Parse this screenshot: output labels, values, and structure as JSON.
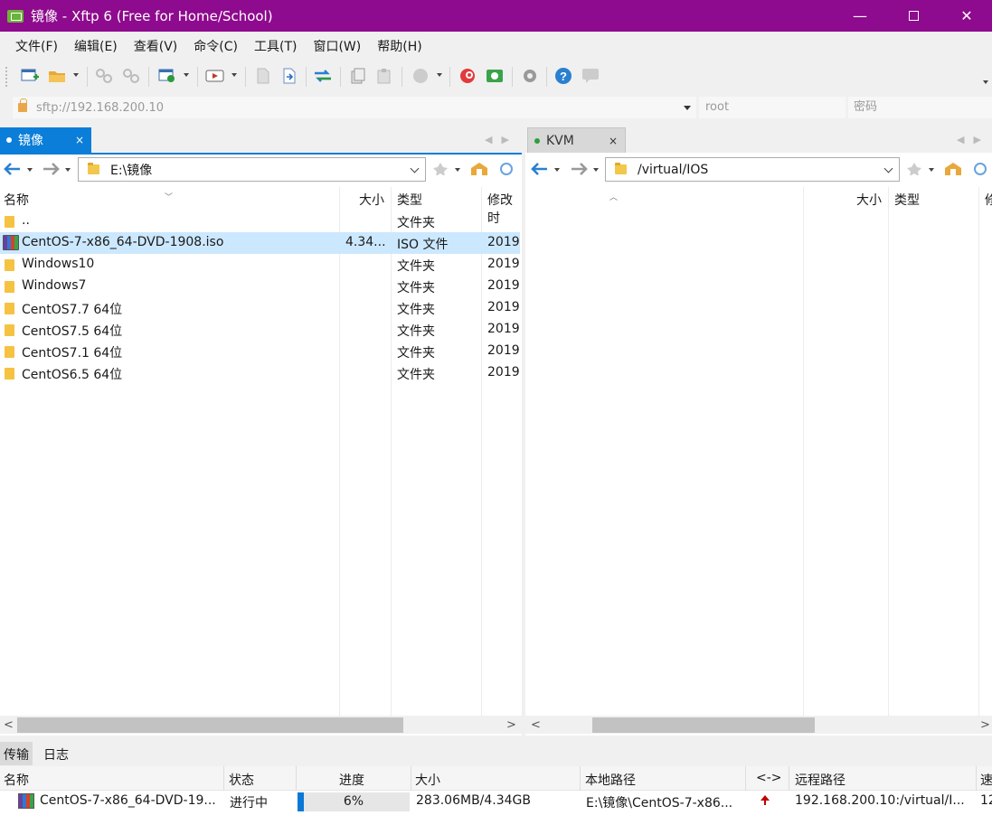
{
  "window": {
    "title": "镜像 - Xftp 6 (Free for Home/School)",
    "controls": {
      "minimize": "—",
      "close": "✕"
    }
  },
  "menu": [
    "文件(F)",
    "编辑(E)",
    "查看(V)",
    "命令(C)",
    "工具(T)",
    "窗口(W)",
    "帮助(H)"
  ],
  "toolbar": {
    "icons": [
      "new-session-icon",
      "open-folder-icon",
      "connect-icon",
      "disconnect-icon",
      "new-tab-icon",
      "terminal-icon",
      "file-icon",
      "transfer-icon",
      "sync-icon",
      "copy-icon",
      "paste-icon",
      "status-icon",
      "xshell-icon",
      "xftp-icon",
      "settings-icon",
      "help-icon",
      "chat-icon"
    ]
  },
  "address": {
    "url": "sftp://192.168.200.10",
    "user_placeholder": "root",
    "password_placeholder": "密码"
  },
  "left_panel": {
    "tab_label": "镜像",
    "tab_close": "×",
    "path": "E:\\镜像",
    "columns": [
      "名称",
      "大小",
      "类型",
      "修改时"
    ],
    "rows": [
      {
        "name": "..",
        "size": "",
        "type": "文件夹",
        "date": ""
      },
      {
        "name": "CentOS-7-x86_64-DVD-1908.iso",
        "size": "4.34...",
        "type": "ISO 文件",
        "date": "2019",
        "selected": true
      },
      {
        "name": "Windows10",
        "size": "",
        "type": "文件夹",
        "date": "2019"
      },
      {
        "name": "Windows7",
        "size": "",
        "type": "文件夹",
        "date": "2019"
      },
      {
        "name": "CentOS7.7 64位",
        "size": "",
        "type": "文件夹",
        "date": "2019"
      },
      {
        "name": "CentOS7.5 64位",
        "size": "",
        "type": "文件夹",
        "date": "2019"
      },
      {
        "name": "CentOS7.1 64位",
        "size": "",
        "type": "文件夹",
        "date": "2019"
      },
      {
        "name": "CentOS6.5 64位",
        "size": "",
        "type": "文件夹",
        "date": "2019"
      }
    ]
  },
  "right_panel": {
    "tab_label": "KVM",
    "tab_close": "×",
    "path": "/virtual/IOS",
    "columns": [
      "大小",
      "类型",
      "修"
    ]
  },
  "bottom": {
    "tabs": [
      "传输",
      "日志"
    ],
    "columns": [
      "名称",
      "状态",
      "进度",
      "大小",
      "本地路径",
      "<->",
      "远程路径",
      "速"
    ],
    "transfer": {
      "name": "CentOS-7-x86_64-DVD-19...",
      "status": "进行中",
      "progress_label": "6%",
      "progress": 0.06,
      "size": "283.06MB/4.34GB",
      "local_path": "E:\\镜像\\CentOS-7-x86...",
      "direction": "up-arrow-icon",
      "remote_path": "192.168.200.10:/virtual/I...",
      "speed": "12"
    }
  },
  "colors": {
    "titlebar": "#8e0a8e",
    "active_tab": "#0a7ed8",
    "selection": "#cce8ff",
    "progress_fill": "#0a78d4"
  }
}
